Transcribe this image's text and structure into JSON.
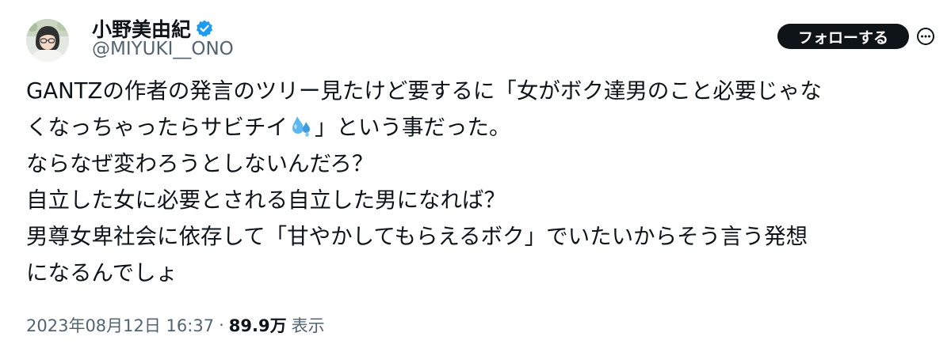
{
  "author": {
    "display_name": "小野美由紀",
    "handle": "@MIYUKI__ONO",
    "avatar_icon": "user-avatar-icon",
    "verified_icon": "verified-badge-icon"
  },
  "follow_button": {
    "label": "フォローする"
  },
  "more_button": {
    "icon": "more-options-icon"
  },
  "tweet": {
    "line1": "GANTZの作者の発言のツリー見たけど要するに「女がボク達男のこと必要じゃな",
    "line2_before_emoji": "くなっちゃったらサビチイ",
    "emoji": "sweat-droplets-emoji",
    "line2_after_emoji": "」という事だった。",
    "line3": "ならなぜ変わろうとしないんだろ？",
    "line4": "自立した女に必要とされる自立した男になれば？",
    "line5": "男尊女卑社会に依存して「甘やかしてもらえるボク」でいたいからそう言う発想",
    "line6": "になるんでしょ"
  },
  "meta": {
    "timestamp": "2023年08月12日 16:37",
    "separator": "·",
    "views_count": "89.9万",
    "views_label": "表示"
  },
  "colors": {
    "text_primary": "#0f1419",
    "text_secondary": "#536471",
    "verified_blue": "#1d9bf0",
    "button_bg": "#0f1419"
  }
}
